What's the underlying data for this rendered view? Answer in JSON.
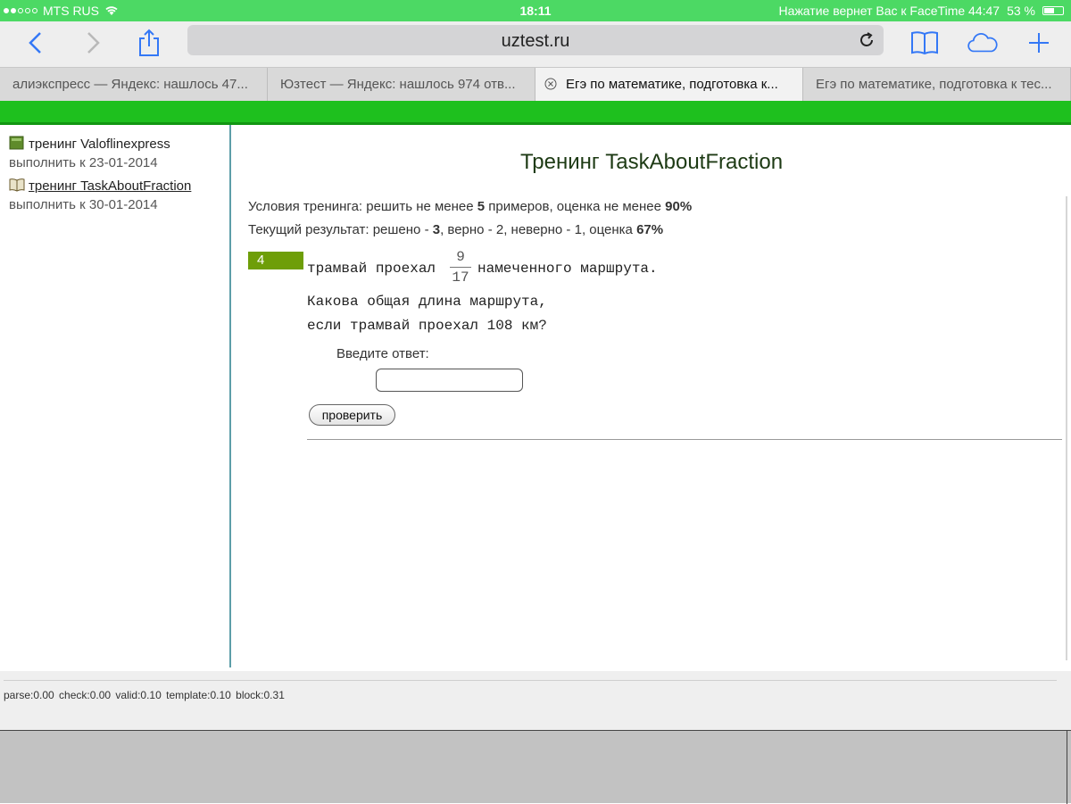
{
  "status_bar": {
    "carrier": "MTS RUS",
    "time": "18:11",
    "facetime_text": "Нажатие вернет Вас к FaceTime 44:47",
    "battery": "53 %"
  },
  "browser": {
    "url": "uztest.ru",
    "tabs": [
      {
        "label": "алиэкспресс — Яндекс: нашлось 47..."
      },
      {
        "label": "Юзтест — Яндекс: нашлось 974 отв..."
      },
      {
        "label": "Егэ по математике, подготовка к..."
      },
      {
        "label": "Егэ по математике, подготовка к тес..."
      }
    ]
  },
  "sidebar": {
    "items": [
      {
        "title": "тренинг Valoflinexpress",
        "date": "выполнить к 23-01-2014"
      },
      {
        "title": "тренинг TaskAboutFraction",
        "date": "выполнить к 30-01-2014"
      }
    ]
  },
  "main": {
    "title": "Тренинг TaskAboutFraction",
    "conditions": {
      "prefix": "Условия тренинга: решить не менее ",
      "min_examples": "5",
      "middle": " примеров, оценка не менее ",
      "min_score": "90%"
    },
    "result": {
      "prefix": "Текущий результат: решено - ",
      "solved": "3",
      "middle": ", верно - 2, неверно - 1, оценка ",
      "score": "67%"
    },
    "task": {
      "number": "4",
      "line1_before": "трамвай проехал",
      "numerator": "9",
      "denominator": "17",
      "line1_after": "намеченного маршрута.",
      "line2": "Какова общая длина маршрута,",
      "line3": "если трамвай проехал 108 км?"
    },
    "answer_label": "Введите ответ:",
    "answer_value": "",
    "check_button": "проверить"
  },
  "footer": {
    "stats": "parse:0.00 check:0.00 valid:0.10 template:0.10 block:0.31"
  },
  "colors": {
    "status_bar": "#4cd964",
    "green_bar": "#1ec01e",
    "task_badge": "#6e9e08",
    "title_text": "#1d3a14"
  }
}
